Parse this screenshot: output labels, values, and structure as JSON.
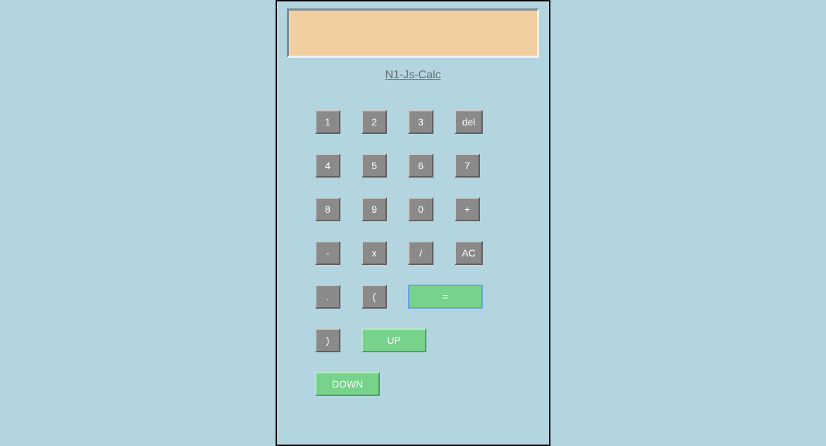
{
  "title": "N1-Js-Calc",
  "display_value": "",
  "buttons": {
    "r1c1": "1",
    "r1c2": "2",
    "r1c3": "3",
    "r1c4": "del",
    "r2c1": "4",
    "r2c2": "5",
    "r2c3": "6",
    "r2c4": "7",
    "r3c1": "8",
    "r3c2": "9",
    "r3c3": "0",
    "r3c4": "+",
    "r4c1": "-",
    "r4c2": "x",
    "r4c3": "/",
    "r4c4": "AC",
    "r5c1": ".",
    "r5c2": "(",
    "r5c3": "=",
    "r6c1": ")",
    "r6c2": "UP",
    "r7c1": "DOWN"
  },
  "colors": {
    "page_bg": "#b3d5e0",
    "display_bg": "#f2cfa0",
    "btn_gray": "#8a8a8a",
    "btn_green": "#77d38b",
    "equals_border": "#6a9fe8"
  }
}
